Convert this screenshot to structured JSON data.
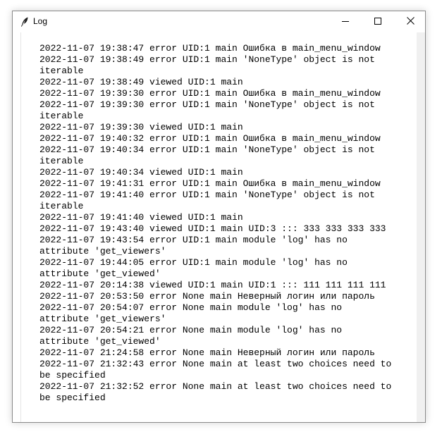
{
  "window": {
    "title": "Log",
    "icon": "feather-icon",
    "controls": {
      "minimize": "minimize-icon",
      "maximize": "maximize-icon",
      "close": "close-icon"
    }
  },
  "log": {
    "lines": [
      "2022-11-07 19:38:47 error UID:1 main Ошибка в main_menu_window",
      "2022-11-07 19:38:49 error UID:1 main 'NoneType' object is not\niterable",
      "2022-11-07 19:38:49 viewed UID:1 main",
      "2022-11-07 19:39:30 error UID:1 main Ошибка в main_menu_window",
      "2022-11-07 19:39:30 error UID:1 main 'NoneType' object is not\niterable",
      "2022-11-07 19:39:30 viewed UID:1 main",
      "2022-11-07 19:40:32 error UID:1 main Ошибка в main_menu_window",
      "2022-11-07 19:40:34 error UID:1 main 'NoneType' object is not\niterable",
      "2022-11-07 19:40:34 viewed UID:1 main",
      "2022-11-07 19:41:31 error UID:1 main Ошибка в main_menu_window",
      "2022-11-07 19:41:40 error UID:1 main 'NoneType' object is not\niterable",
      "2022-11-07 19:41:40 viewed UID:1 main",
      "2022-11-07 19:43:40 viewed UID:1 main UID:3 ::: 333 333 333 333",
      "2022-11-07 19:43:54 error UID:1 main module 'log' has no\nattribute 'get_viewers'",
      "2022-11-07 19:44:05 error UID:1 main module 'log' has no\nattribute 'get_viewed'",
      "2022-11-07 20:14:38 viewed UID:1 main UID:1 ::: 111 111 111 111",
      "2022-11-07 20:53:50 error None main Неверный логин или пароль",
      "2022-11-07 20:54:07 error None main module 'log' has no\nattribute 'get_viewers'",
      "2022-11-07 20:54:21 error None main module 'log' has no\nattribute 'get_viewed'",
      "2022-11-07 21:24:58 error None main Неверный логин или пароль",
      "2022-11-07 21:32:43 error None main at least two choices need to\nbe specified",
      "2022-11-07 21:32:52 error None main at least two choices need to\nbe specified"
    ]
  }
}
